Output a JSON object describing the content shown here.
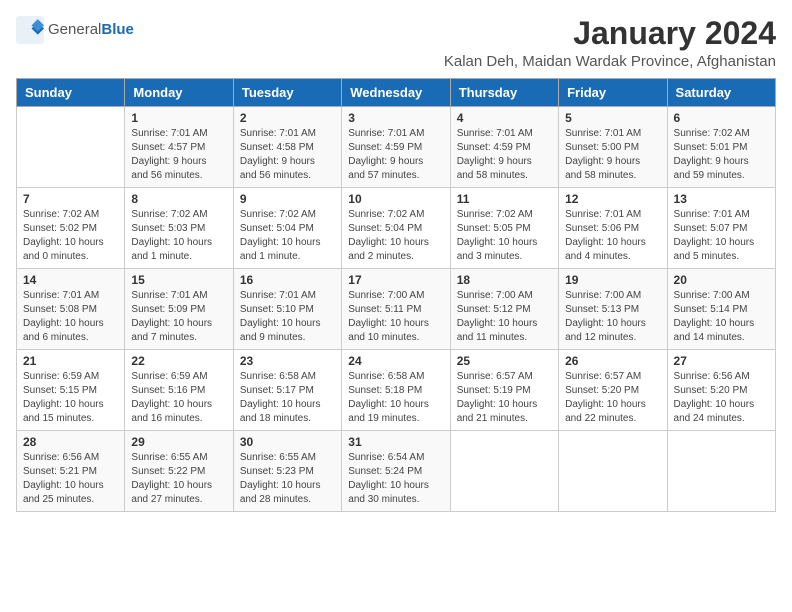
{
  "header": {
    "logo_general": "General",
    "logo_blue": "Blue",
    "title": "January 2024",
    "subtitle": "Kalan Deh, Maidan Wardak Province, Afghanistan"
  },
  "weekdays": [
    "Sunday",
    "Monday",
    "Tuesday",
    "Wednesday",
    "Thursday",
    "Friday",
    "Saturday"
  ],
  "weeks": [
    [
      {
        "day": "",
        "info": ""
      },
      {
        "day": "1",
        "info": "Sunrise: 7:01 AM\nSunset: 4:57 PM\nDaylight: 9 hours\nand 56 minutes."
      },
      {
        "day": "2",
        "info": "Sunrise: 7:01 AM\nSunset: 4:58 PM\nDaylight: 9 hours\nand 56 minutes."
      },
      {
        "day": "3",
        "info": "Sunrise: 7:01 AM\nSunset: 4:59 PM\nDaylight: 9 hours\nand 57 minutes."
      },
      {
        "day": "4",
        "info": "Sunrise: 7:01 AM\nSunset: 4:59 PM\nDaylight: 9 hours\nand 58 minutes."
      },
      {
        "day": "5",
        "info": "Sunrise: 7:01 AM\nSunset: 5:00 PM\nDaylight: 9 hours\nand 58 minutes."
      },
      {
        "day": "6",
        "info": "Sunrise: 7:02 AM\nSunset: 5:01 PM\nDaylight: 9 hours\nand 59 minutes."
      }
    ],
    [
      {
        "day": "7",
        "info": "Sunrise: 7:02 AM\nSunset: 5:02 PM\nDaylight: 10 hours\nand 0 minutes."
      },
      {
        "day": "8",
        "info": "Sunrise: 7:02 AM\nSunset: 5:03 PM\nDaylight: 10 hours\nand 1 minute."
      },
      {
        "day": "9",
        "info": "Sunrise: 7:02 AM\nSunset: 5:04 PM\nDaylight: 10 hours\nand 1 minute."
      },
      {
        "day": "10",
        "info": "Sunrise: 7:02 AM\nSunset: 5:04 PM\nDaylight: 10 hours\nand 2 minutes."
      },
      {
        "day": "11",
        "info": "Sunrise: 7:02 AM\nSunset: 5:05 PM\nDaylight: 10 hours\nand 3 minutes."
      },
      {
        "day": "12",
        "info": "Sunrise: 7:01 AM\nSunset: 5:06 PM\nDaylight: 10 hours\nand 4 minutes."
      },
      {
        "day": "13",
        "info": "Sunrise: 7:01 AM\nSunset: 5:07 PM\nDaylight: 10 hours\nand 5 minutes."
      }
    ],
    [
      {
        "day": "14",
        "info": "Sunrise: 7:01 AM\nSunset: 5:08 PM\nDaylight: 10 hours\nand 6 minutes."
      },
      {
        "day": "15",
        "info": "Sunrise: 7:01 AM\nSunset: 5:09 PM\nDaylight: 10 hours\nand 7 minutes."
      },
      {
        "day": "16",
        "info": "Sunrise: 7:01 AM\nSunset: 5:10 PM\nDaylight: 10 hours\nand 9 minutes."
      },
      {
        "day": "17",
        "info": "Sunrise: 7:00 AM\nSunset: 5:11 PM\nDaylight: 10 hours\nand 10 minutes."
      },
      {
        "day": "18",
        "info": "Sunrise: 7:00 AM\nSunset: 5:12 PM\nDaylight: 10 hours\nand 11 minutes."
      },
      {
        "day": "19",
        "info": "Sunrise: 7:00 AM\nSunset: 5:13 PM\nDaylight: 10 hours\nand 12 minutes."
      },
      {
        "day": "20",
        "info": "Sunrise: 7:00 AM\nSunset: 5:14 PM\nDaylight: 10 hours\nand 14 minutes."
      }
    ],
    [
      {
        "day": "21",
        "info": "Sunrise: 6:59 AM\nSunset: 5:15 PM\nDaylight: 10 hours\nand 15 minutes."
      },
      {
        "day": "22",
        "info": "Sunrise: 6:59 AM\nSunset: 5:16 PM\nDaylight: 10 hours\nand 16 minutes."
      },
      {
        "day": "23",
        "info": "Sunrise: 6:58 AM\nSunset: 5:17 PM\nDaylight: 10 hours\nand 18 minutes."
      },
      {
        "day": "24",
        "info": "Sunrise: 6:58 AM\nSunset: 5:18 PM\nDaylight: 10 hours\nand 19 minutes."
      },
      {
        "day": "25",
        "info": "Sunrise: 6:57 AM\nSunset: 5:19 PM\nDaylight: 10 hours\nand 21 minutes."
      },
      {
        "day": "26",
        "info": "Sunrise: 6:57 AM\nSunset: 5:20 PM\nDaylight: 10 hours\nand 22 minutes."
      },
      {
        "day": "27",
        "info": "Sunrise: 6:56 AM\nSunset: 5:20 PM\nDaylight: 10 hours\nand 24 minutes."
      }
    ],
    [
      {
        "day": "28",
        "info": "Sunrise: 6:56 AM\nSunset: 5:21 PM\nDaylight: 10 hours\nand 25 minutes."
      },
      {
        "day": "29",
        "info": "Sunrise: 6:55 AM\nSunset: 5:22 PM\nDaylight: 10 hours\nand 27 minutes."
      },
      {
        "day": "30",
        "info": "Sunrise: 6:55 AM\nSunset: 5:23 PM\nDaylight: 10 hours\nand 28 minutes."
      },
      {
        "day": "31",
        "info": "Sunrise: 6:54 AM\nSunset: 5:24 PM\nDaylight: 10 hours\nand 30 minutes."
      },
      {
        "day": "",
        "info": ""
      },
      {
        "day": "",
        "info": ""
      },
      {
        "day": "",
        "info": ""
      }
    ]
  ]
}
